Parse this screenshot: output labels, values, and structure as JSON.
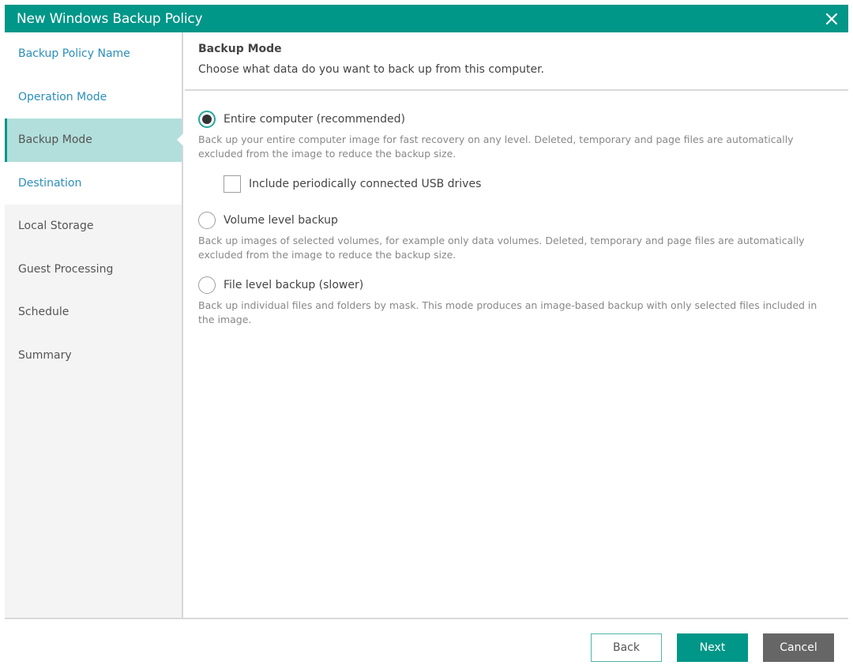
{
  "window": {
    "title": "New Windows Backup Policy",
    "close_icon": "close-icon"
  },
  "colors": {
    "accent": "#009688",
    "active_step_bg": "#b2dfdb",
    "visited_step_text": "#2a8fbd",
    "cancel_bg": "#666666"
  },
  "sidebar": {
    "items": [
      {
        "label": "Backup Policy Name",
        "state": "visited"
      },
      {
        "label": "Operation Mode",
        "state": "visited"
      },
      {
        "label": "Backup Mode",
        "state": "active"
      },
      {
        "label": "Destination",
        "state": "visited"
      },
      {
        "label": "Local Storage",
        "state": "pending"
      },
      {
        "label": "Guest Processing",
        "state": "pending"
      },
      {
        "label": "Schedule",
        "state": "pending"
      },
      {
        "label": "Summary",
        "state": "pending"
      }
    ]
  },
  "main": {
    "title": "Backup Mode",
    "subtitle": "Choose what data do you want to back up from this computer.",
    "options": [
      {
        "label": "Entire computer (recommended)",
        "checked": true,
        "description": "Back up your entire computer image for fast recovery on any level. Deleted, temporary and page files are automatically excluded from the image to reduce the backup size."
      },
      {
        "label": "Volume level backup",
        "checked": false,
        "description": "Back up images of selected volumes, for example only data volumes. Deleted, temporary and page files are automatically excluded from the image to reduce the backup size."
      },
      {
        "label": "File level backup (slower)",
        "checked": false,
        "description": "Back up individual files and folders by mask. This mode produces an image-based backup with only selected files included in the image."
      }
    ],
    "usb_checkbox": {
      "label": "Include periodically connected USB drives",
      "checked": false
    }
  },
  "footer": {
    "back_label": "Back",
    "next_label": "Next",
    "cancel_label": "Cancel"
  }
}
